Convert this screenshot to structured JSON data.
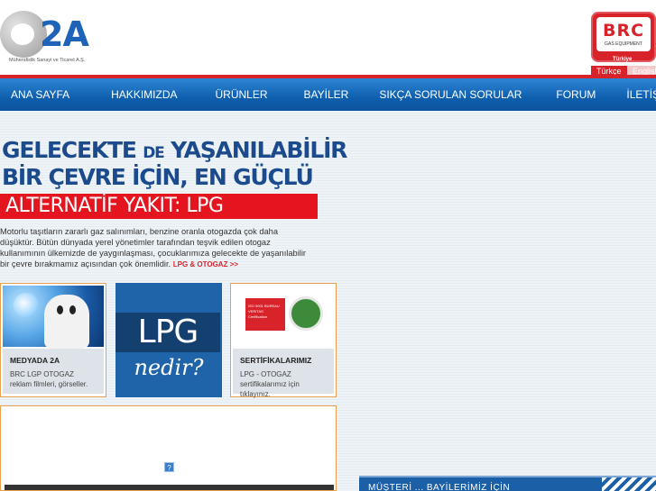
{
  "header": {
    "logo_text": "2A",
    "logo_sub": "Mühendislik Sanayi ve Ticaret A.Ş.",
    "brc_text": "BRC",
    "brc_sub": "GAS EQUIPMENT",
    "brc_country": "Türkiye",
    "languages": [
      "Türkçe",
      "English"
    ]
  },
  "nav": {
    "items": [
      "ANA SAYFA",
      "HAKKIMIZDA",
      "ÜRÜNLER",
      "BAYİLER",
      "SIKÇA SORULAN SORULAR",
      "FORUM",
      "İLETİŞİM"
    ]
  },
  "hero": {
    "line1_a": "GELECEKTE ",
    "line1_b": "DE",
    "line1_c": " YAŞANILABİLİR",
    "line2": "BİR ÇEVRE İÇİN, EN GÜÇLÜ",
    "band": "ALTERNATİF YAKIT: LPG",
    "intro": "Motorlu taşıtların zararlı gaz salınımları, benzine oranla otogazda çok daha düşüktür. Bütün dünyada yerel yönetimler tarafından teşvik edilen otogaz kullanımının ülkemizde de yaygınlaşması, çocuklarımıza gelecekte de yaşanılabilir bir çevre bırakmamız açısından çok önemlidir.",
    "intro_link": "LPG & OTOGAZ >>"
  },
  "cards": {
    "medya": {
      "title": "MEDYADA 2A",
      "desc": "BRC LGP OTOGAZ reklam filmleri, görseller."
    },
    "lpg": {
      "title": "LPG",
      "sub": "nedir?"
    },
    "cert": {
      "title": "SERTİFİKALARIMIZ",
      "desc": "LPG - OTOGAZ sertifikalarımız için tıklayınız.",
      "badge": "ISO 9001 BUREAU VERITAS Certification"
    }
  },
  "bottom": {
    "qmark": "?",
    "promo": "MÜŞTERİ ... BAYİLERİMİZ İÇİN"
  },
  "colors": {
    "brand_blue": "#1b4b8c",
    "brand_red": "#d8232a",
    "nav_blue": "#0f5fae"
  }
}
